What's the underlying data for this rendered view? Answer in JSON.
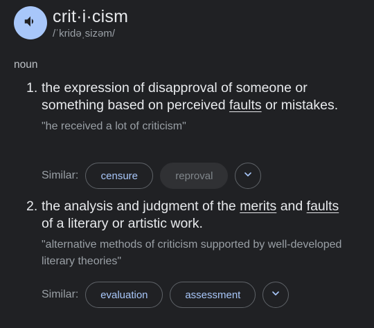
{
  "entry": {
    "word": "crit·i·cism",
    "phonetic": "/ˈkridəˌsizəm/",
    "part_of_speech": "noun",
    "speaker_icon": "volume-icon"
  },
  "senses": [
    {
      "number": "1.",
      "definition_parts": [
        "the expression of disapproval of someone or something based on perceived ",
        "faults",
        " or mistakes."
      ],
      "example": "\"he received a lot of criticism\"",
      "similar_label": "Similar:",
      "similar": [
        "censure",
        "reproval"
      ],
      "expand_icon": "chevron-down-icon"
    },
    {
      "number": "2.",
      "definition_parts": [
        "the analysis and judgment of the ",
        "merits",
        " and ",
        "faults",
        " of a literary or artistic work."
      ],
      "example": "\"alternative methods of criticism supported by well-developed literary theories\"",
      "similar_label": "Similar:",
      "similar": [
        "evaluation",
        "assessment"
      ],
      "expand_icon": "chevron-down-icon"
    }
  ],
  "colors": {
    "background": "#202124",
    "accent": "#a8c7fa",
    "muted_text": "#9aa0a6",
    "chip_border": "#5f6368"
  }
}
